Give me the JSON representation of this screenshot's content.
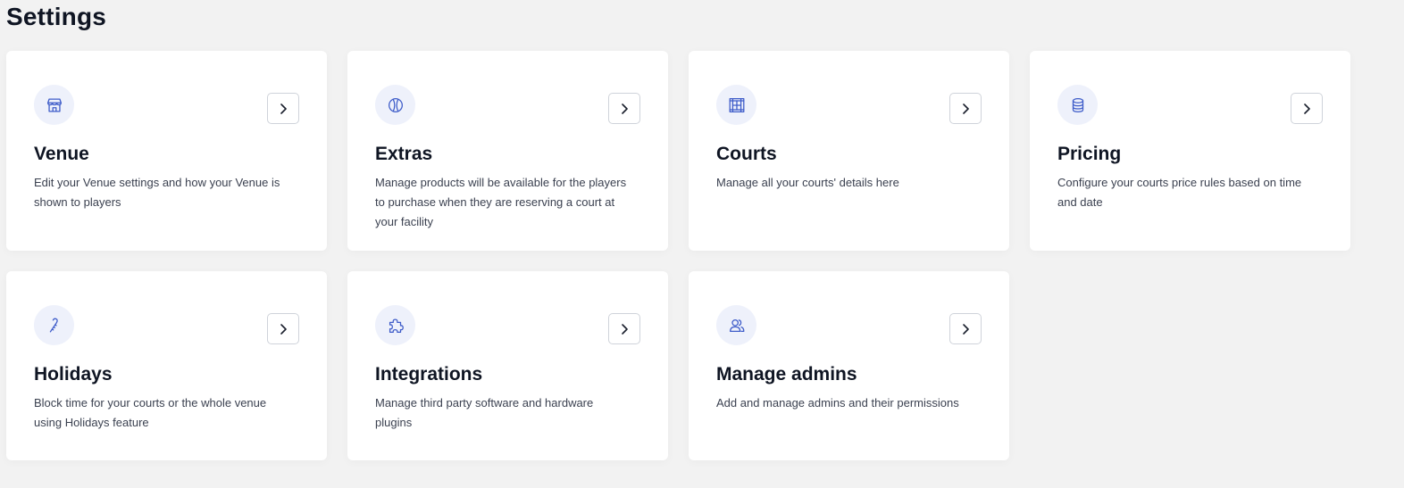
{
  "page": {
    "title": "Settings"
  },
  "colors": {
    "background": "#f2f2f2",
    "card": "#ffffff",
    "icon_accent": "#3e5cc9",
    "icon_bg": "#eef1fb"
  },
  "cards": [
    {
      "title": "Venue",
      "description": "Edit your Venue settings and how your Venue is shown to players",
      "icon": "store-icon"
    },
    {
      "title": "Extras",
      "description": "Manage products will be available for the players to purchase when they are reserving a court at your facility",
      "icon": "ball-icon"
    },
    {
      "title": "Courts",
      "description": "Manage all your courts' details here",
      "icon": "court-icon"
    },
    {
      "title": "Pricing",
      "description": "Configure your courts price rules based on time and date",
      "icon": "coins-icon"
    },
    {
      "title": "Holidays",
      "description": "Block time for your courts or the whole venue using Holidays feature",
      "icon": "candy-cane-icon"
    },
    {
      "title": "Integrations",
      "description": "Manage third party software and hardware plugins",
      "icon": "puzzle-icon"
    },
    {
      "title": "Manage admins",
      "description": "Add and manage admins and their permissions",
      "icon": "users-icon"
    }
  ]
}
